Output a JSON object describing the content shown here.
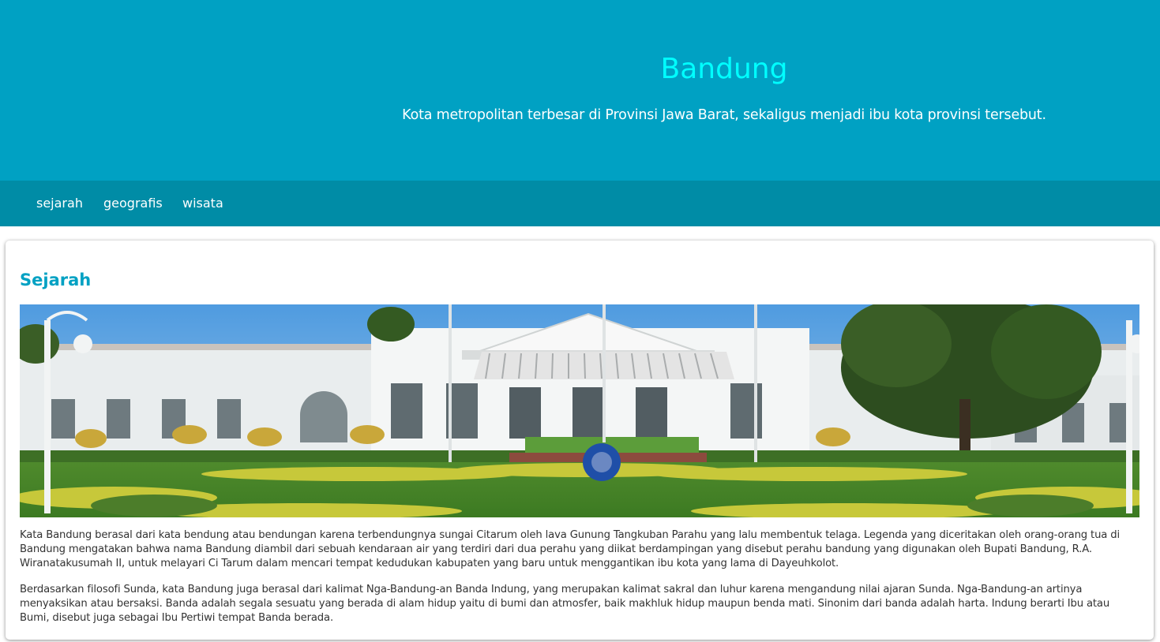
{
  "header": {
    "title": "Bandung",
    "subtitle": "Kota metropolitan terbesar di Provinsi Jawa Barat, sekaligus menjadi ibu kota provinsi tersebut."
  },
  "nav": {
    "items": [
      {
        "label": "sejarah"
      },
      {
        "label": "geografis"
      },
      {
        "label": "wisata"
      }
    ]
  },
  "section": {
    "heading": "Sejarah",
    "image_alt": "Gedung Pakuan, Bandung",
    "paragraphs": [
      "Kata Bandung berasal dari kata bendung atau bendungan karena terbendungnya sungai Citarum oleh lava Gunung Tangkuban Parahu yang lalu membentuk telaga. Legenda yang diceritakan oleh orang-orang tua di Bandung mengatakan bahwa nama Bandung diambil dari sebuah kendaraan air yang terdiri dari dua perahu yang diikat berdampingan yang disebut perahu bandung yang digunakan oleh Bupati Bandung, R.A. Wiranatakusumah II, untuk melayari Ci Tarum dalam mencari tempat kedudukan kabupaten yang baru untuk menggantikan ibu kota yang lama di Dayeuhkolot.",
      "Berdasarkan filosofi Sunda, kata Bandung juga berasal dari kalimat Nga-Bandung-an Banda Indung, yang merupakan kalimat sakral dan luhur karena mengandung nilai ajaran Sunda. Nga-Bandung-an artinya menyaksikan atau bersaksi. Banda adalah segala sesuatu yang berada di alam hidup yaitu di bumi dan atmosfer, baik makhluk hidup maupun benda mati. Sinonim dari banda adalah harta. Indung berarti Ibu atau Bumi, disebut juga sebagai Ibu Pertiwi tempat Banda berada."
    ]
  },
  "colors": {
    "header_bg": "#00a1c3",
    "nav_bg": "#008ca6",
    "title": "#00ffff",
    "heading": "#00a1c3"
  }
}
